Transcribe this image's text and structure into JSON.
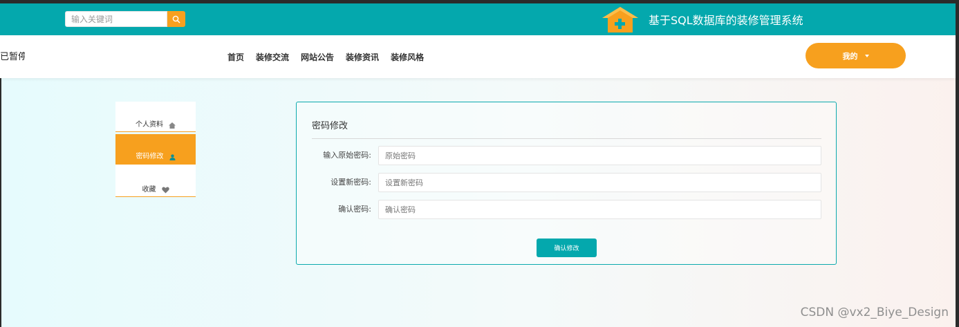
{
  "header": {
    "search_placeholder": "输入关键词",
    "site_title": "基于SQL数据库的装修管理系统",
    "icons": {
      "search": "search-icon",
      "logo": "house-plus-icon"
    },
    "colors": {
      "header_bg": "#04a8ad",
      "accent": "#f7a01e"
    }
  },
  "nav": {
    "clipped_text": "已暂停",
    "links": [
      "首页",
      "装修交流",
      "网站公告",
      "装修资讯",
      "装修风格"
    ],
    "my_button": "我的"
  },
  "sidebar": {
    "items": [
      {
        "label": "个人资料",
        "icon": "home-icon"
      },
      {
        "label": "密码修改",
        "icon": "user-icon",
        "active": true
      },
      {
        "label": "收藏",
        "icon": "heart-icon"
      }
    ]
  },
  "form": {
    "title": "密码修改",
    "fields": [
      {
        "label": "输入原始密码:",
        "placeholder": "原始密码"
      },
      {
        "label": "设置新密码:",
        "placeholder": "设置新密码"
      },
      {
        "label": "确认密码:",
        "placeholder": "确认密码"
      }
    ],
    "submit_label": "确认修改"
  },
  "watermark": "CSDN @vx2_Biye_Design"
}
